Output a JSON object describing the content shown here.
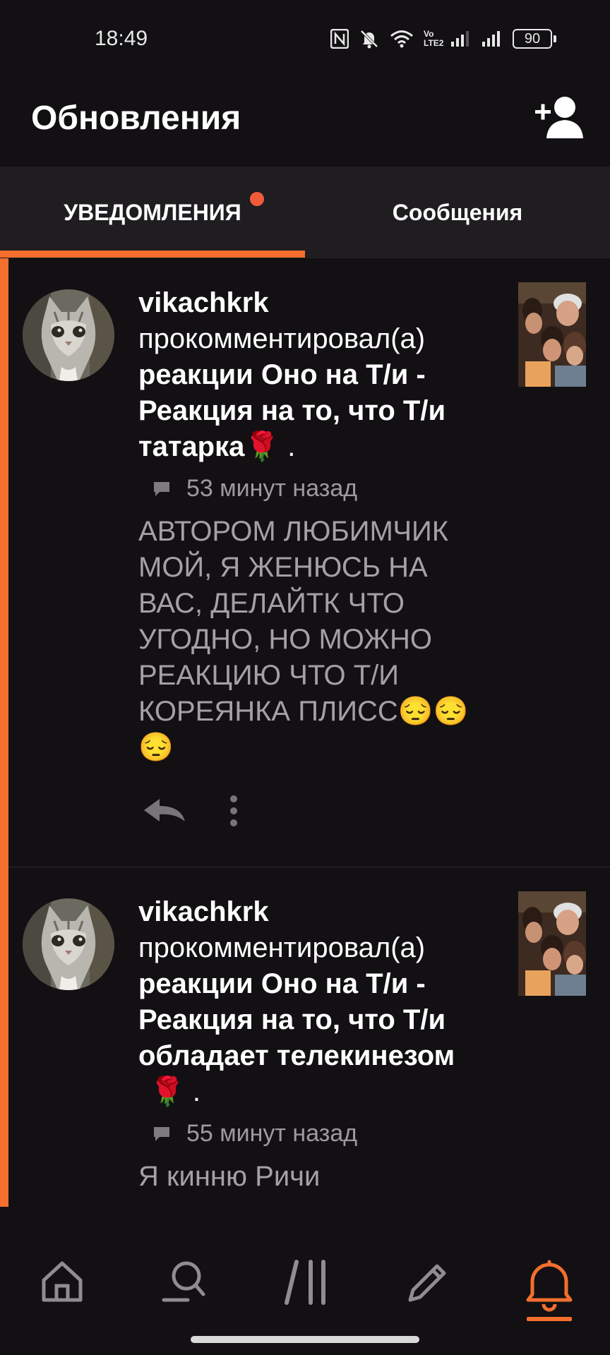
{
  "status_bar": {
    "time": "18:49",
    "icons": [
      "nfc-icon",
      "mute-icon",
      "wifi-icon",
      "volte-icon",
      "signal-icon",
      "signal-icon",
      "battery-icon"
    ],
    "volte_text": "Vo LTE2",
    "battery": "90"
  },
  "header": {
    "title": "Обновления",
    "add_friend_icon": "add-user-icon"
  },
  "tabs": [
    {
      "label": "УВЕДОМЛЕНИЯ",
      "active": true,
      "has_dot": true
    },
    {
      "label": "Сообщения",
      "active": false,
      "has_dot": false
    }
  ],
  "notifications": [
    {
      "user": "vikachkrk",
      "action": "прокомментировал(а)",
      "post_lines": [
        "реакции Оно на Т/и -",
        "Реакция на то, что Т/и",
        "татарка"
      ],
      "post_tail": "🌹 .",
      "time": "53 минут назад",
      "comment": "АВТОРОМ ЛЮБИМЧИК МОЙ, Я ЖЕНЮСЬ НА ВАС, ДЕЛАЙТК ЧТО УГОДНО, НО МОЖНО РЕАКЦИЮ ЧТО Т/И КОРЕЯНКА ПЛИСС😔😔😔",
      "unread": true
    },
    {
      "user": "vikachkrk",
      "action": "прокомментировал(а)",
      "post_lines": [
        "реакции Оно на Т/и -",
        "Реакция на то, что Т/и",
        "обладает телекинезом"
      ],
      "post_tail": "🌹 .",
      "time": "55 минут назад",
      "comment": "Я кинню Ричи",
      "unread": true
    }
  ],
  "bottom_nav": [
    {
      "icon": "home-icon",
      "active": false
    },
    {
      "icon": "search-icon",
      "active": false
    },
    {
      "icon": "library-icon",
      "active": false
    },
    {
      "icon": "pencil-icon",
      "active": false
    },
    {
      "icon": "bell-icon",
      "active": true
    }
  ],
  "colors": {
    "accent": "#f36f2d",
    "background": "#121013",
    "tab_bar": "#1f1d20",
    "secondary_text": "#9c9a9d",
    "notification_dot": "#f25a3c"
  }
}
